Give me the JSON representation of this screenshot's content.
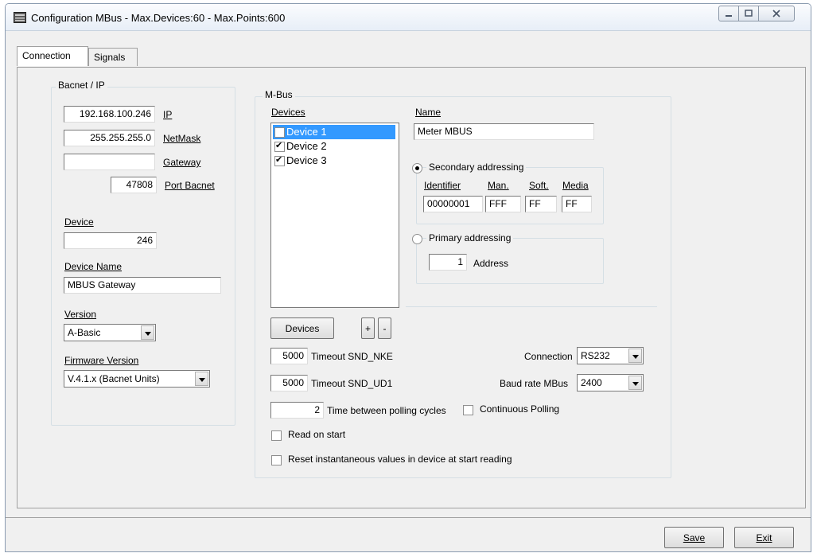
{
  "window": {
    "title": "Configuration MBus - Max.Devices:60 - Max.Points:600"
  },
  "tabs": [
    {
      "label": "Connection",
      "active": true
    },
    {
      "label": "Signals",
      "active": false
    }
  ],
  "bacnet": {
    "group_title": "Bacnet / IP",
    "ip_value": "192.168.100.246",
    "ip_label": "IP",
    "netmask_value": "255.255.255.0",
    "netmask_label": "NetMask",
    "gateway_value": "",
    "gateway_label": "Gateway",
    "port_value": "47808",
    "port_label": "Port Bacnet",
    "device_label": "Device",
    "device_value": "246",
    "device_name_label": "Device Name",
    "device_name_value": "MBUS Gateway",
    "version_label": "Version",
    "version_value": "A-Basic",
    "firmware_label": "Firmware Version",
    "firmware_value": "V.4.1.x (Bacnet Units)"
  },
  "mbus": {
    "group_title": "M-Bus",
    "devices_label": "Devices",
    "devices": [
      {
        "label": "Device 1",
        "checked": true,
        "selected": true
      },
      {
        "label": "Device 2",
        "checked": true,
        "selected": false
      },
      {
        "label": "Device 3",
        "checked": true,
        "selected": false
      }
    ],
    "name_label": "Name",
    "name_value": "Meter MBUS",
    "secondary_label": "Secondary addressing",
    "identifier_label": "Identifier",
    "identifier_value": "00000001",
    "man_label": "Man.",
    "man_value": "FFF",
    "soft_label": "Soft.",
    "soft_value": "FF",
    "media_label": "Media",
    "media_value": "FF",
    "primary_label": "Primary addressing",
    "address_value": "1",
    "address_label": "Address",
    "devices_button": "Devices",
    "add_button": "+",
    "remove_button": "-",
    "timeout_nke_value": "5000",
    "timeout_nke_label": "Timeout SND_NKE",
    "timeout_ud1_value": "5000",
    "timeout_ud1_label": "Timeout SND_UD1",
    "connection_label": "Connection",
    "connection_value": "RS232",
    "baud_label": "Baud rate MBus",
    "baud_value": "2400",
    "polling_value": "2",
    "polling_label": "Time between polling cycles",
    "continuous_label": "Continuous Polling",
    "read_on_start_label": "Read on start",
    "reset_label": "Reset instantaneous values in device at start reading"
  },
  "footer": {
    "save_label": "Save",
    "exit_label": "Exit"
  },
  "icons": {
    "app": "app-window-icon",
    "minimize": "minimize-icon",
    "maximize": "maximize-icon",
    "close": "close-icon"
  }
}
